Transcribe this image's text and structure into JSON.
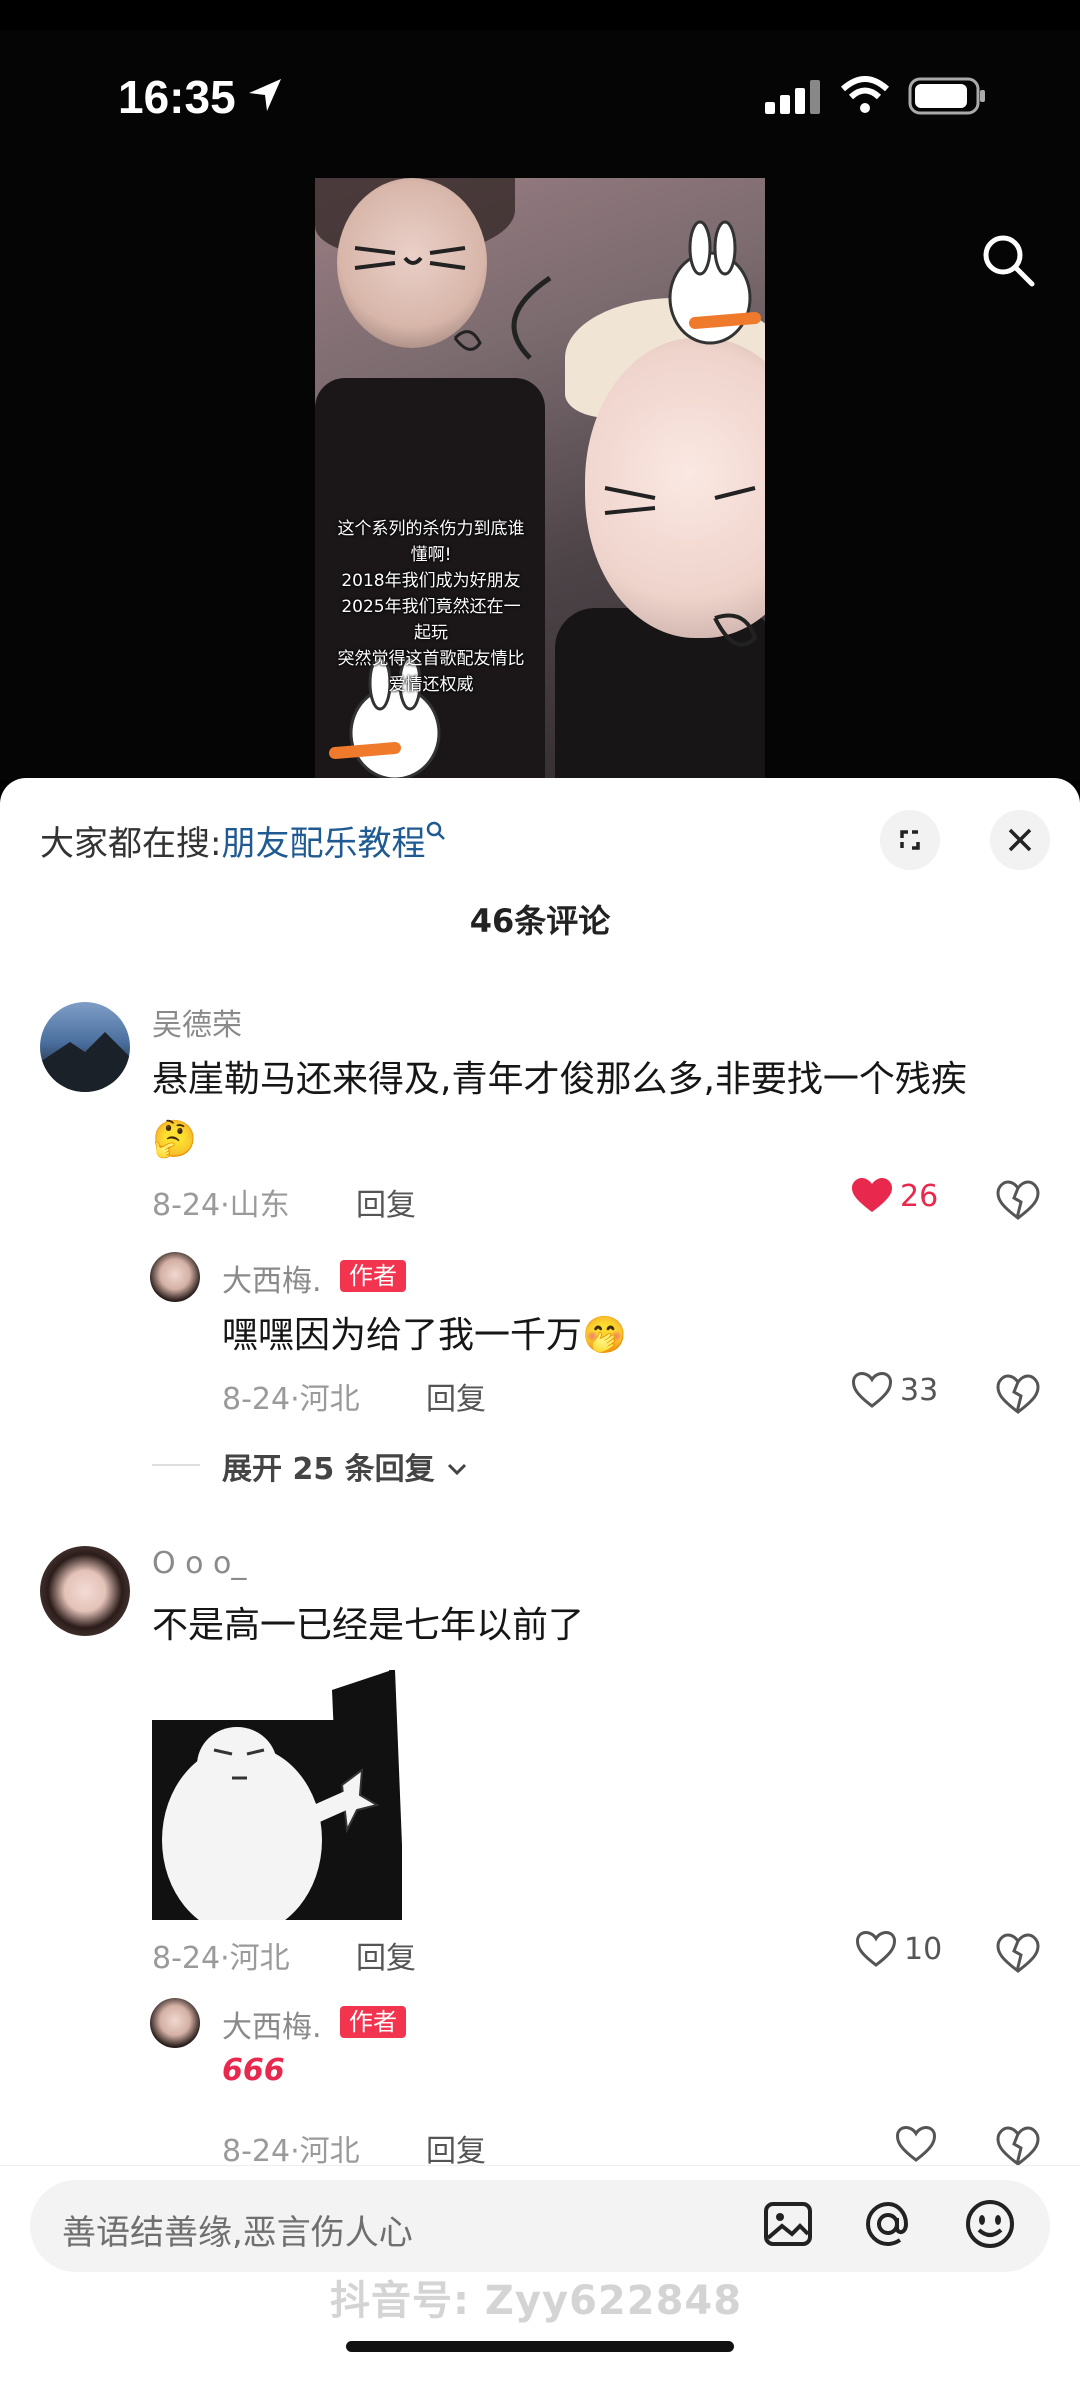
{
  "status_bar": {
    "time": "16:35"
  },
  "video": {
    "caption_lines": [
      "这个系列的杀伤力到底谁",
      "懂啊!",
      "2018年我们成为好朋友",
      "2025年我们竟然还在一",
      "起玩",
      "突然觉得这首歌配友情比",
      "爱情还权威"
    ]
  },
  "search_hint": {
    "prefix": "大家都在搜:",
    "keyword": "朋友配乐教程"
  },
  "comment_count": "46条评论",
  "comments": [
    {
      "user": "吴德荣",
      "text_line1": "悬崖勒马还来得及,青年才俊那么多,非要找一个残疾",
      "emoji": "🤔",
      "date": "8-24",
      "region": "山东",
      "reply_label": "回复",
      "likes": "26",
      "reply": {
        "user": "大西梅.",
        "badge": "作者",
        "text": "嘿嘿因为给了我一千万",
        "emoji": "🤭",
        "date": "8-24",
        "region": "河北",
        "reply_label": "回复",
        "likes": "33"
      },
      "expand_label": "展开 25 条回复"
    },
    {
      "user": "O o o_",
      "text": "不是高一已经是七年以前了",
      "date": "8-24",
      "region": "河北",
      "reply_label": "回复",
      "likes": "10",
      "reply": {
        "user": "大西梅.",
        "badge": "作者",
        "text": "666",
        "date": "8-24",
        "region": "河北",
        "reply_label": "回复",
        "likes": ""
      }
    }
  ],
  "input": {
    "placeholder": "善语结善缘,恶言伤人心"
  },
  "watermark": "抖音号: Zyy622848",
  "colors": {
    "accent_red": "#e8284c",
    "badge_red": "#f2344e",
    "keyword_blue": "#1f5a92"
  }
}
